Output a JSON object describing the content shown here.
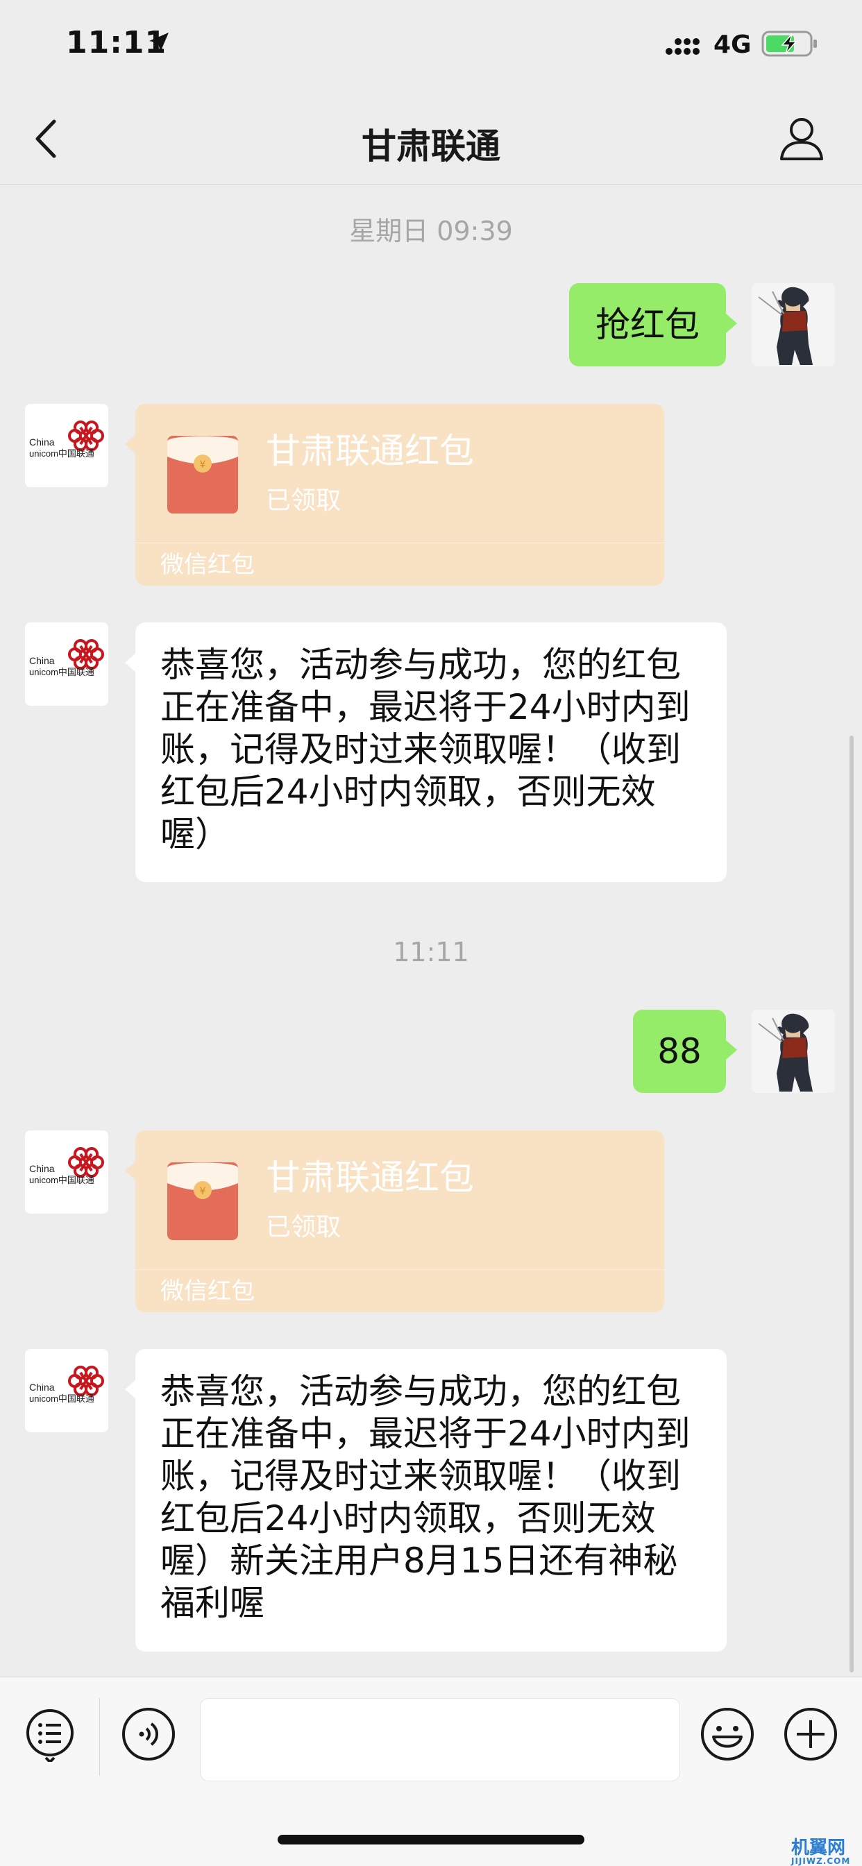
{
  "status_bar": {
    "time": "11:11",
    "network": "4G",
    "icons": [
      "location-arrow-icon",
      "signal-icon",
      "battery-charging-icon"
    ]
  },
  "nav": {
    "title": "甘肃联通",
    "back_icon": "chevron-left-icon",
    "profile_icon": "person-icon"
  },
  "messages": {
    "ts1": "星期日 09:39",
    "m1": "抢红包",
    "rp1": {
      "title": "甘肃联通红包",
      "status": "已领取",
      "footer": "微信红包"
    },
    "m2": "恭喜您，活动参与成功，您的红包正在准备中，最迟将于24小时内到账，记得及时过来领取喔！（收到红包后24小时内领取，否则无效喔）",
    "ts2": "11:11",
    "m3": "88",
    "rp2": {
      "title": "甘肃联通红包",
      "status": "已领取",
      "footer": "微信红包"
    },
    "m4": "恭喜您，活动参与成功，您的红包正在准备中，最迟将于24小时内到账，记得及时过来领取喔！（收到红包后24小时内领取，否则无效喔）新关注用户8月15日还有神秘福利喔"
  },
  "avatars": {
    "unicom_line1": "China",
    "unicom_line2": "unicom中国联通"
  },
  "input_bar": {
    "icons": [
      "menu-list-icon",
      "voice-icon",
      "emoji-icon",
      "plus-icon"
    ]
  },
  "watermark": {
    "text": "机翼网",
    "sub": "JIJIWZ.COM"
  },
  "colors": {
    "sent_bubble": "#95ec69",
    "red_packet": "#f9e1c4",
    "background": "#ededed"
  }
}
